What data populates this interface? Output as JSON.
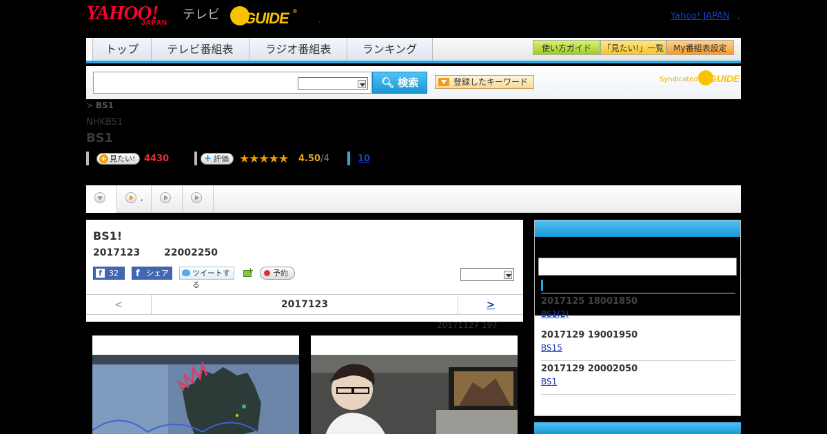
{
  "header": {
    "yahoo_logo": "YAHOO!",
    "yahoo_sub": "JAPAN",
    "tv_label": "テレビ",
    "gguide_logo": "GUIDE",
    "gguide_reg": "®",
    "yahoo_japan_link": "Yahoo! JAPAN",
    "sep_dot_left": ",",
    "sep_dot_right": ","
  },
  "nav": {
    "tabs": [
      "トップ",
      "テレビ番組表",
      "ラジオ番組表",
      "ランキング"
    ],
    "buttons": [
      "使い方ガイド",
      "「見たい!」一覧",
      "My番組表設定"
    ]
  },
  "search": {
    "input_value": "",
    "button_label": "検索",
    "keyword_button": "登録したキーワード",
    "syndicated_label": "Syndicated",
    "syndicated_logo": "GUIDE"
  },
  "program": {
    "breadcrumb_arrow": ">",
    "breadcrumb_current": "BS1",
    "channel_sub": "NHKBS1",
    "channel_title": "BS1",
    "want_label": "見たい!",
    "want_count": "4430",
    "rate_label": "評価",
    "stars": "★★★★★",
    "score": "4.50",
    "score_max": "/4",
    "review_link": "10"
  },
  "tabs": [
    {
      "label": ""
    },
    {
      "label": ","
    },
    {
      "label": ""
    },
    {
      "label": ""
    }
  ],
  "main": {
    "title": "BS1!",
    "date": "2017123",
    "time": "22002250",
    "fb_like_count": "32",
    "fb_share_label": "シェア",
    "tweet_label": "ツイートする",
    "reserve_label": "予約",
    "pager_prev": "<",
    "pager_date": "2017123",
    "pager_next": ">",
    "note": "20171127  197"
  },
  "sidebar": {
    "items": [
      {
        "date": "2017125  18001850",
        "link": "BS1(2)"
      },
      {
        "date": "2017129  19001950",
        "link": "BS15"
      },
      {
        "date": "2017129  20002050",
        "link": "BS1"
      }
    ]
  },
  "colors": {
    "accent_blue": "#2aa6e0",
    "want_red": "#e8283c",
    "star_orange": "#f3a000",
    "link_blue": "#1a3db8"
  }
}
